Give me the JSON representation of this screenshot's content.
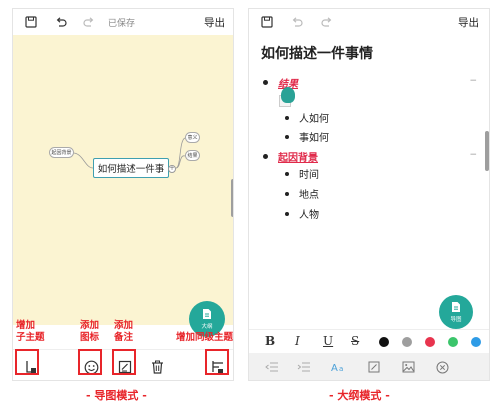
{
  "left": {
    "toolbar": {
      "saved_text": "已保存",
      "export_label": "导出"
    },
    "map": {
      "central_topic": "如何描述一件事",
      "left_topic": "起因背景",
      "right_topics": [
        "意义",
        "结果"
      ],
      "plus": "+"
    },
    "fab_label": "大纲",
    "annotations": {
      "add_subtopic": [
        "增加",
        "子主题"
      ],
      "add_icon": [
        "添加",
        "图标"
      ],
      "add_note": [
        "添加",
        "备注"
      ],
      "add_sibling": "增加同级主题"
    },
    "caption": "- 导图模式 -"
  },
  "right": {
    "toolbar": {
      "export_label": "导出"
    },
    "title": "如何描述一件事情",
    "items": [
      {
        "label": "结果",
        "collapse": "−"
      },
      {
        "label": "人如何"
      },
      {
        "label": "事如何"
      },
      {
        "label": "起因背景",
        "collapse": "−"
      },
      {
        "label": "时间"
      },
      {
        "label": "地点"
      },
      {
        "label": "人物"
      }
    ],
    "fab_label": "导图",
    "format": {
      "bold": "B",
      "italic": "I",
      "underline": "U",
      "strike": "S"
    },
    "colors": [
      "#111111",
      "#9e9e9e",
      "#e8344e",
      "#3bc56b",
      "#2e9be6"
    ],
    "caption": "- 大纲模式 -"
  }
}
